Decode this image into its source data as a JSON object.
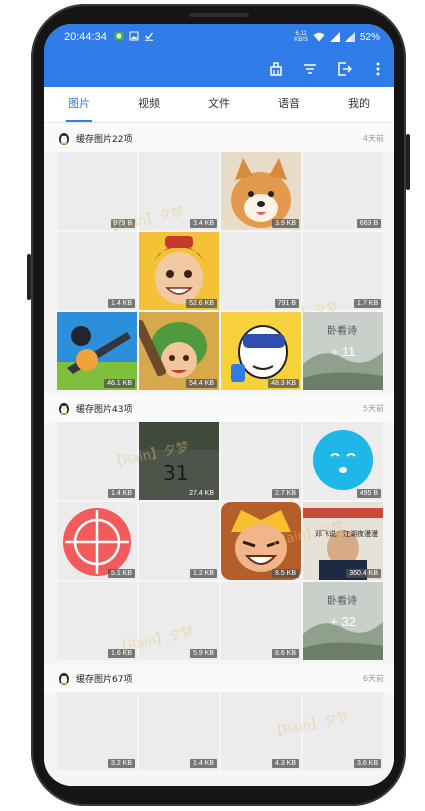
{
  "status": {
    "time": "20:44:34",
    "net_speed_value": "6.11",
    "net_speed_unit": "KB/S",
    "battery": "52%"
  },
  "toolbar": {
    "icons": [
      "clean-icon",
      "filter-icon",
      "export-icon",
      "more-vert-icon"
    ]
  },
  "tabs": [
    {
      "label": "图片",
      "active": true
    },
    {
      "label": "视频",
      "active": false
    },
    {
      "label": "文件",
      "active": false
    },
    {
      "label": "语音",
      "active": false
    },
    {
      "label": "我的",
      "active": false
    }
  ],
  "watermark": "【Rain】夕梦",
  "sections": [
    {
      "title": "缓存图片22项",
      "age": "4天前",
      "cells": [
        {
          "size": "879 B",
          "thumb": "blank"
        },
        {
          "size": "3.4 KB",
          "thumb": "blank"
        },
        {
          "size": "3.9 KB",
          "thumb": "dog"
        },
        {
          "size": "663 B",
          "thumb": "blank"
        },
        {
          "size": "1.4 KB",
          "thumb": "blank"
        },
        {
          "size": "52.6 KB",
          "thumb": "boy"
        },
        {
          "size": "791 B",
          "thumb": "blank"
        },
        {
          "size": "1.7 KB",
          "thumb": "blank"
        },
        {
          "size": "46.1 KB",
          "thumb": "game-blue"
        },
        {
          "size": "54.4 KB",
          "thumb": "game-green"
        },
        {
          "size": "48.3 KB",
          "thumb": "game-yellow"
        },
        {
          "size": "",
          "thumb": "landscape",
          "more": "+ 11"
        }
      ]
    },
    {
      "title": "缓存图片43项",
      "age": "5天前",
      "cells": [
        {
          "size": "1.4 KB",
          "thumb": "blank"
        },
        {
          "size": "27.4 KB",
          "thumb": "dark-31"
        },
        {
          "size": "2.7 KB",
          "thumb": "blank"
        },
        {
          "size": "495 B",
          "thumb": "face"
        },
        {
          "size": "5.1 KB",
          "thumb": "ball"
        },
        {
          "size": "1.2 KB",
          "thumb": "blank"
        },
        {
          "size": "8.5 KB",
          "thumb": "clash"
        },
        {
          "size": "360.4 KB",
          "thumb": "news"
        },
        {
          "size": "1.6 KB",
          "thumb": "blank"
        },
        {
          "size": "5.9 KB",
          "thumb": "blank"
        },
        {
          "size": "8.6 KB",
          "thumb": "blank"
        },
        {
          "size": "",
          "thumb": "landscape",
          "more": "+ 32"
        }
      ]
    },
    {
      "title": "缓存图片67项",
      "age": "6天前",
      "cells": [
        {
          "size": "3.2 KB",
          "thumb": "blank"
        },
        {
          "size": "1.4 KB",
          "thumb": "blank"
        },
        {
          "size": "4.3 KB",
          "thumb": "blank"
        },
        {
          "size": "3.6 KB",
          "thumb": "blank"
        }
      ]
    }
  ],
  "thumb_text": {
    "dark_number": "31",
    "landscape_caption": "卧看诗",
    "news_caption": "邓飞说：江湖夜漫漫"
  },
  "colors": {
    "accent": "#2f7be7",
    "size_badge": "#505050"
  }
}
